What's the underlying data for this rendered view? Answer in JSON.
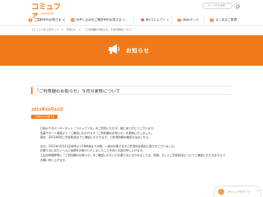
{
  "brand": {
    "logo": "コミュファ",
    "logo_sub": "commufa"
  },
  "search": {
    "placeholder": "サイト内を検索"
  },
  "nav": {
    "items": [
      {
        "label": "ご契約中のお客さま",
        "icon": "user-icon"
      },
      {
        "label": "お申し込みをご検討中のお客さま",
        "icon": "checklist-icon"
      },
      {
        "label": "Myコミュファ",
        "icon": "heart-icon"
      },
      {
        "label": "Webメール",
        "icon": "mail-icon"
      },
      {
        "label": "よくあるご質問",
        "icon": "question-icon"
      }
    ]
  },
  "breadcrumb": [
    "コミュファ光 公式サイト",
    ">",
    "お知らせ",
    ">",
    "「ご利用額のお知らせ」９月分更新について"
  ],
  "banner": {
    "title": "お知らせ",
    "icon": "megaphone-icon"
  },
  "article": {
    "title": "「ご利用額のお知らせ」９月分更新について",
    "date": "2011年10月12日",
    "category": "ご契約中のお客さま",
    "paragraphs": [
      "日頃より光インターネット「コミュファ光」をご利用いただき、誠にありがとうございます。",
      "会員サポート画面より「ご確認いただけます「ご利用額のお知らせ」を更新いたしました。",
      "現在、2011年9月ご利用料金までご確認いただけます。ご利用明細の確認方法はこちら。",
      "",
      "なお、2011年10月11日本時より16時頃までの間、一部のお客さまのご利用料金表記に誤りがございました。",
      "お客さまにはたいへんご迷惑をお掛けいたしましたことを深くお詫び申し上げます。",
      "上記お時間帯等に「ご利用額のお知らせ」をご確認いただいたお客さまにおかれましては、再度、正しいご利用料金についてご確認いただきますよう",
      "お願い申し上げます。"
    ]
  },
  "chat": {
    "label": "チャットサポート",
    "close": "×"
  },
  "colors": {
    "accent": "#f07a1a",
    "chat_green": "#4a9a3e"
  }
}
